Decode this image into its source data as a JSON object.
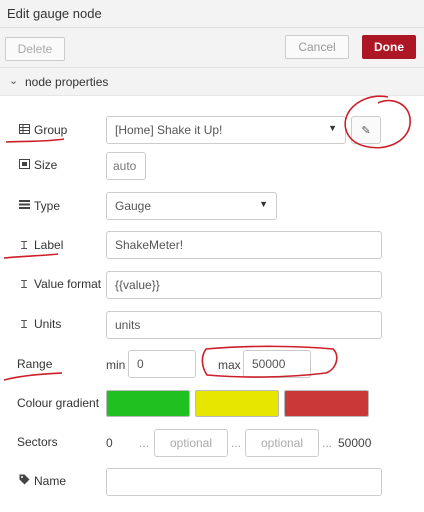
{
  "window": {
    "title": "Edit gauge node"
  },
  "toolbar": {
    "delete_label": "Delete",
    "cancel_label": "Cancel",
    "done_label": "Done"
  },
  "section": {
    "chevron": "⌄",
    "label": "node properties"
  },
  "icons": {
    "group": "table-icon",
    "size": "resize-icon",
    "type": "list-icon",
    "label": "text-cursor-icon",
    "value_format": "text-cursor-icon",
    "units": "text-cursor-icon",
    "name": "tag-icon",
    "edit": "pencil-icon"
  },
  "form": {
    "group": {
      "label": "Group",
      "value": "[Home] Shake it Up!"
    },
    "size": {
      "label": "Size",
      "value": "auto"
    },
    "type": {
      "label": "Type",
      "value": "Gauge"
    },
    "node_label": {
      "label": "Label",
      "value": "ShakeMeter!"
    },
    "value_format": {
      "label": "Value format",
      "value": "{{value}}"
    },
    "units": {
      "label": "Units",
      "value": "units"
    },
    "range": {
      "label": "Range",
      "min_label": "min",
      "min_value": "0",
      "max_label": "max",
      "max_value": "50000"
    },
    "colour_gradient": {
      "label": "Colour gradient",
      "colors": [
        "#1fc01f",
        "#e6e600",
        "#ca3838"
      ]
    },
    "sectors": {
      "label": "Sectors",
      "start": "0",
      "dots1": "...",
      "placeholder1": "optional",
      "dots2": "...",
      "placeholder2": "optional",
      "dots3": "...",
      "end": "50000"
    },
    "name": {
      "label": "Name",
      "value": ""
    }
  },
  "annotation_color": "#cc1f2a"
}
